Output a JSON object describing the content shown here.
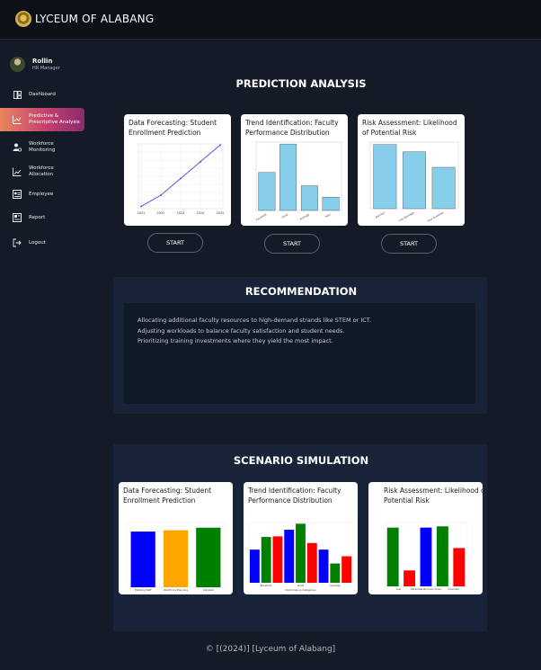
{
  "brand": {
    "name": "LYCEUM OF ALABANG"
  },
  "user": {
    "name": "Rollin",
    "role": "HR Manager"
  },
  "sidebar": {
    "items": [
      {
        "label": "Dashboard",
        "icon": "dashboard-icon"
      },
      {
        "label": "Predictive & Prescriptive Analysis",
        "icon": "chart-line-icon",
        "active": true
      },
      {
        "label": "Workforce Monitoring",
        "icon": "users-gear-icon"
      },
      {
        "label": "Workforce Allocation",
        "icon": "chart-up-icon"
      },
      {
        "label": "Employee",
        "icon": "id-card-icon"
      },
      {
        "label": "Report",
        "icon": "report-icon"
      },
      {
        "label": "Logout",
        "icon": "logout-icon"
      }
    ]
  },
  "prediction": {
    "title": "PREDICTION ANALYSIS",
    "cards": [
      {
        "title": "Data Forecasting: Student Enrollment Prediction",
        "button": "START"
      },
      {
        "title": "Trend Identification: Faculty Performance Distribution",
        "button": "START"
      },
      {
        "title": "Risk Assessment: Likelihood of Potential Risk",
        "button": "START"
      }
    ]
  },
  "recommendation": {
    "title": "RECOMMENDATION",
    "lines": [
      "Allocating additional faculty resources to high-demand strands like STEM or ICT.",
      "Adjusting workloads to balance faculty satisfaction and student needs.",
      "Prioritizing training investments where they yield the most impact."
    ]
  },
  "scenario": {
    "title": "SCENARIO SIMULATION",
    "cards": [
      {
        "title": "Data Forecasting: Student Enrollment Prediction"
      },
      {
        "title": "Trend Identification: Faculty Performance Distribution"
      },
      {
        "title": "Risk Assessment: Likelihood of Potential Risk"
      }
    ]
  },
  "footer": {
    "text": "© [(2024)] [Lyceum of Alabang]"
  },
  "colors": {
    "accent_start": "#e9845f",
    "accent_end": "#8c2a6b",
    "bar_blue": "#87ceeb",
    "line_blue": "#2b3fd6"
  },
  "chart_data": [
    {
      "type": "line",
      "x": [
        2021,
        2022,
        2023,
        2024,
        2025
      ],
      "xticks": [
        "2021",
        "2022",
        "2023",
        "2024",
        "2025"
      ],
      "series": [
        {
          "values": [
            1000,
            1100,
            1250,
            1400,
            1550
          ]
        }
      ],
      "ylim": [
        980,
        1560
      ]
    },
    {
      "type": "bar",
      "categories": [
        "Excellent",
        "Good",
        "Average",
        "Poor"
      ],
      "values": [
        10,
        17.5,
        6.5,
        3.5
      ],
      "ylim": [
        0,
        18
      ],
      "xlabel": "Performance Level"
    },
    {
      "type": "bar",
      "categories": [
        "Burnout",
        "Resource Shortage",
        "Administrative Overload"
      ],
      "values": [
        0.79,
        0.7,
        0.51
      ],
      "ylim": [
        0,
        0.82
      ]
    },
    {
      "type": "bar",
      "categories": [
        "Existing Staff",
        "Workforce Planning",
        "Adjusted"
      ],
      "bars": [
        {
          "value": 0.86,
          "color": "#0000ff"
        },
        {
          "value": 0.88,
          "color": "#ffa500"
        },
        {
          "value": 0.92,
          "color": "#008000"
        }
      ],
      "ylim": [
        0,
        1
      ]
    },
    {
      "type": "bar",
      "categories": [
        "Excellent",
        "Good",
        "Average"
      ],
      "bars": [
        {
          "value": 0.55,
          "color": "#0000ff"
        },
        {
          "value": 0.76,
          "color": "#008000"
        },
        {
          "value": 0.77,
          "color": "#ff0000"
        },
        {
          "value": 0.88,
          "color": "#0000ff"
        },
        {
          "value": 0.98,
          "color": "#008000"
        },
        {
          "value": 0.66,
          "color": "#ff0000"
        },
        {
          "value": 0.55,
          "color": "#0000ff"
        },
        {
          "value": 0.32,
          "color": "#008000"
        },
        {
          "value": 0.44,
          "color": "#ff0000"
        }
      ],
      "xlabel": "Performance Categories",
      "ylim": [
        0,
        1
      ]
    },
    {
      "type": "bar",
      "categories": [
        "Low",
        "Moderate Burnout Crisis",
        "Overload"
      ],
      "bars": [
        {
          "value": 0.92,
          "color": "#008000"
        },
        {
          "value": 0.25,
          "color": "#ff0000"
        },
        {
          "value": 0.92,
          "color": "#0000ff"
        },
        {
          "value": 0.94,
          "color": "#008000"
        },
        {
          "value": 0.6,
          "color": "#ff0000"
        }
      ],
      "xlabel": "Scenarios",
      "ylim": [
        0,
        1
      ]
    }
  ]
}
